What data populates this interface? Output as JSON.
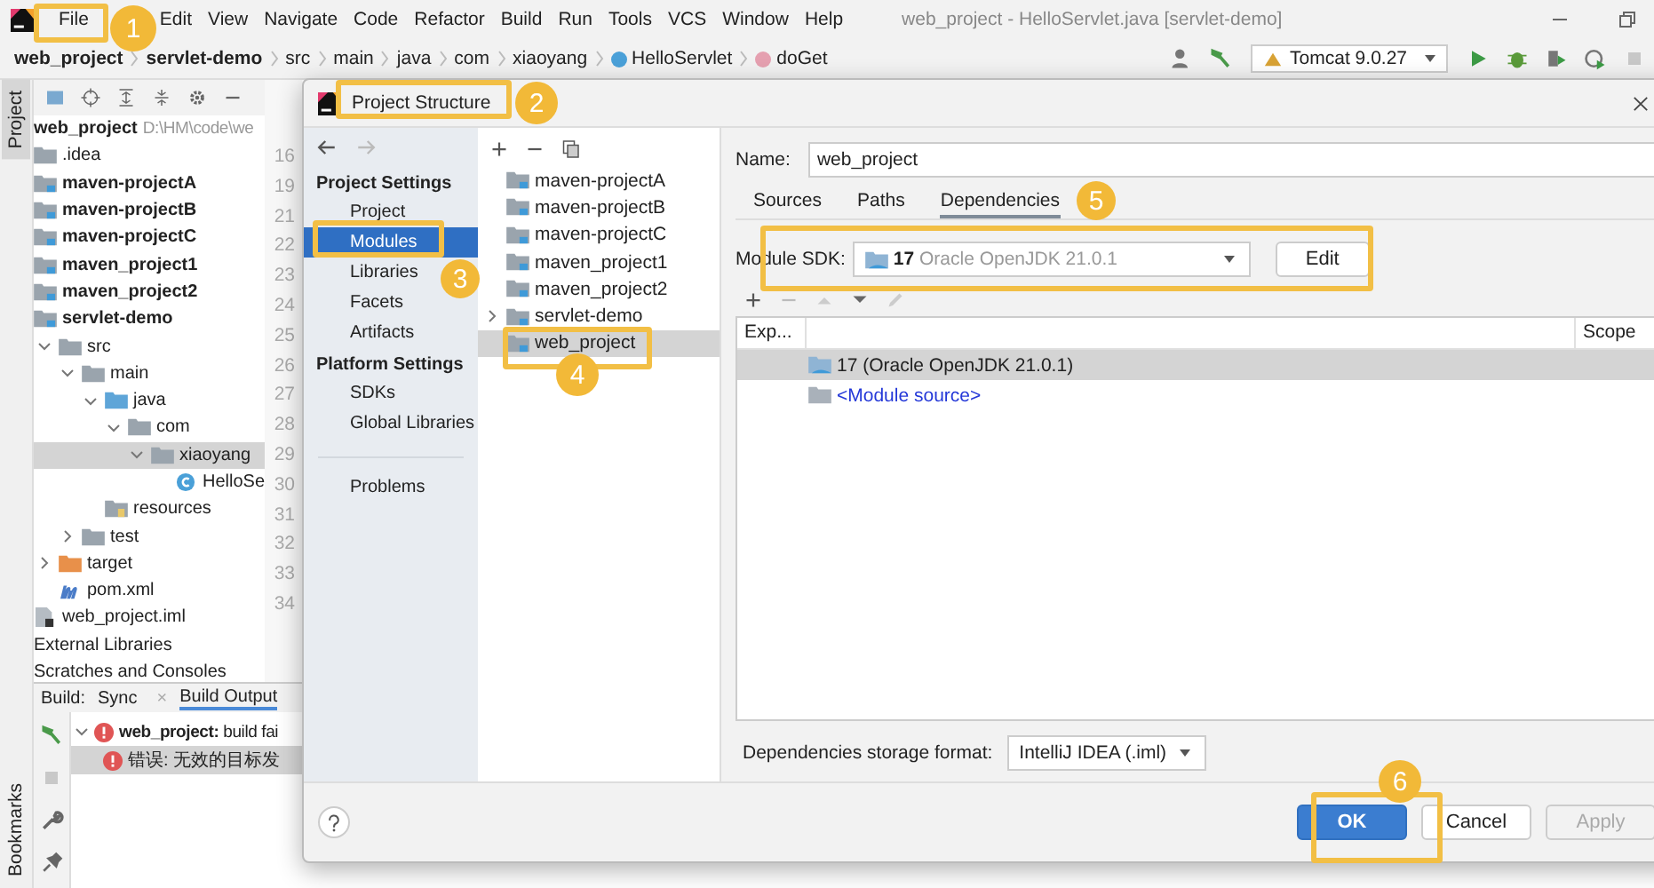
{
  "menu": [
    "File",
    "Edit",
    "View",
    "Navigate",
    "Code",
    "Refactor",
    "Build",
    "Run",
    "Tools",
    "VCS",
    "Window",
    "Help"
  ],
  "window_title": "web_project - HelloServlet.java [servlet-demo]",
  "breadcrumbs": [
    {
      "label": "web_project",
      "kind": "bold"
    },
    {
      "label": "servlet-demo",
      "kind": "bold"
    },
    {
      "label": "src",
      "kind": "plain"
    },
    {
      "label": "main",
      "kind": "plain"
    },
    {
      "label": "java",
      "kind": "plain"
    },
    {
      "label": "com",
      "kind": "plain"
    },
    {
      "label": "xiaoyang",
      "kind": "plain"
    },
    {
      "label": "HelloServlet",
      "kind": "class"
    },
    {
      "label": "doGet",
      "kind": "method"
    }
  ],
  "run_config": "Tomcat 9.0.27",
  "side_tabs": {
    "top": "Project",
    "bottom": "Bookmarks"
  },
  "project_panel": {
    "root": {
      "name": "web_project",
      "path": "D:\\HM\\code\\we"
    },
    "tree": [
      {
        "name": ".idea",
        "kind": "folder",
        "bold": false,
        "selected": false
      },
      {
        "name": "maven-projectA",
        "kind": "module",
        "bold": true,
        "selected": false
      },
      {
        "name": "maven-projectB",
        "kind": "module",
        "bold": true,
        "selected": false
      },
      {
        "name": "maven-projectC",
        "kind": "module",
        "bold": true,
        "selected": false
      },
      {
        "name": "maven_project1",
        "kind": "module",
        "bold": true,
        "selected": false
      },
      {
        "name": "maven_project2",
        "kind": "module",
        "bold": true,
        "selected": false
      },
      {
        "name": "servlet-demo",
        "kind": "module",
        "bold": true,
        "selected": false,
        "children": [
          {
            "name": "src",
            "kind": "folder",
            "bold": false,
            "expanded": true,
            "selected": false,
            "children": [
              {
                "name": "main",
                "kind": "folder",
                "bold": false,
                "expanded": true,
                "selected": false,
                "children": [
                  {
                    "name": "java",
                    "kind": "source",
                    "bold": false,
                    "expanded": true,
                    "selected": false,
                    "children": [
                      {
                        "name": "com",
                        "kind": "package",
                        "bold": false,
                        "expanded": true,
                        "selected": false,
                        "children": [
                          {
                            "name": "xiaoyang",
                            "kind": "package",
                            "bold": false,
                            "expanded": true,
                            "selected": true,
                            "children": [
                              {
                                "name": "HelloSe",
                                "kind": "class",
                                "bold": false,
                                "selected": false
                              }
                            ]
                          }
                        ]
                      }
                    ]
                  },
                  {
                    "name": "resources",
                    "kind": "resources",
                    "bold": false,
                    "selected": false
                  }
                ]
              },
              {
                "name": "test",
                "kind": "folder",
                "bold": false,
                "expanded": false,
                "selected": false
              }
            ]
          },
          {
            "name": "target",
            "kind": "excluded",
            "bold": false,
            "expanded": false,
            "selected": false
          },
          {
            "name": "pom.xml",
            "kind": "maven",
            "bold": false,
            "selected": false
          }
        ]
      },
      {
        "name": "web_project.iml",
        "kind": "iml",
        "bold": false,
        "selected": false
      },
      {
        "name": "External Libraries",
        "kind": "plain",
        "bold": false,
        "selected": false
      },
      {
        "name": "Scratches and Consoles",
        "kind": "plain",
        "bold": false,
        "selected": false
      }
    ]
  },
  "gutter": [
    "16",
    "19",
    "21",
    "22",
    "23",
    "24",
    "25",
    "26",
    "27",
    "28",
    "29",
    "30",
    "31",
    "32",
    "33",
    "34"
  ],
  "build": {
    "label": "Build:",
    "tabs": [
      {
        "label": "Sync",
        "selected": false,
        "close": "×"
      },
      {
        "label": "Build Output",
        "selected": true
      }
    ],
    "messages": [
      {
        "text": "**web_project:** build fai",
        "expanded": true,
        "selected": false,
        "children": [
          {
            "text": "错误: 无效的目标发",
            "selected": true
          }
        ]
      }
    ]
  },
  "dialog": {
    "title": "Project Structure",
    "nav": [
      {
        "kind": "header",
        "label": "Project Settings"
      },
      {
        "kind": "item",
        "label": "Project",
        "selected": false
      },
      {
        "kind": "item",
        "label": "Modules",
        "selected": true
      },
      {
        "kind": "item",
        "label": "Libraries",
        "selected": false
      },
      {
        "kind": "item",
        "label": "Facets",
        "selected": false
      },
      {
        "kind": "item",
        "label": "Artifacts",
        "selected": false
      },
      {
        "kind": "header",
        "label": "Platform Settings"
      },
      {
        "kind": "item",
        "label": "SDKs",
        "selected": false
      },
      {
        "kind": "item",
        "label": "Global Libraries",
        "selected": false
      },
      {
        "kind": "separator"
      },
      {
        "kind": "item",
        "label": "Problems",
        "selected": false
      }
    ],
    "modules": [
      {
        "name": "maven-projectA",
        "selected": false
      },
      {
        "name": "maven-projectB",
        "selected": false
      },
      {
        "name": "maven-projectC",
        "selected": false
      },
      {
        "name": "maven_project1",
        "selected": false
      },
      {
        "name": "maven_project2",
        "selected": false
      },
      {
        "name": "servlet-demo",
        "expanded": false,
        "selected": false
      },
      {
        "name": "web_project",
        "selected": true
      }
    ],
    "name_label": "Name:",
    "name_value": "web_project",
    "tabs": [
      {
        "label": "Sources",
        "selected": false
      },
      {
        "label": "Paths",
        "selected": false
      },
      {
        "label": "Dependencies",
        "selected": true
      }
    ],
    "sdk_label": "Module SDK:",
    "sdk_version": "17",
    "sdk_detail": "Oracle OpenJDK 21.0.1",
    "edit_button": "Edit",
    "columns": [
      "Exp...",
      "Scope"
    ],
    "dependencies": [
      {
        "text": "17 (Oracle OpenJDK 21.0.1)",
        "kind": "sdk",
        "selected": true
      },
      {
        "text": "<Module source>",
        "kind": "source",
        "selected": false
      }
    ],
    "storage_label": "Dependencies storage format:",
    "storage_value": "IntelliJ IDEA (.iml)",
    "buttons": [
      {
        "label": "OK",
        "kind": "primary"
      },
      {
        "label": "Cancel",
        "kind": "normal"
      },
      {
        "label": "Apply",
        "kind": "disabled"
      }
    ]
  },
  "annotations": [
    "1",
    "2",
    "3",
    "4",
    "5",
    "6"
  ]
}
